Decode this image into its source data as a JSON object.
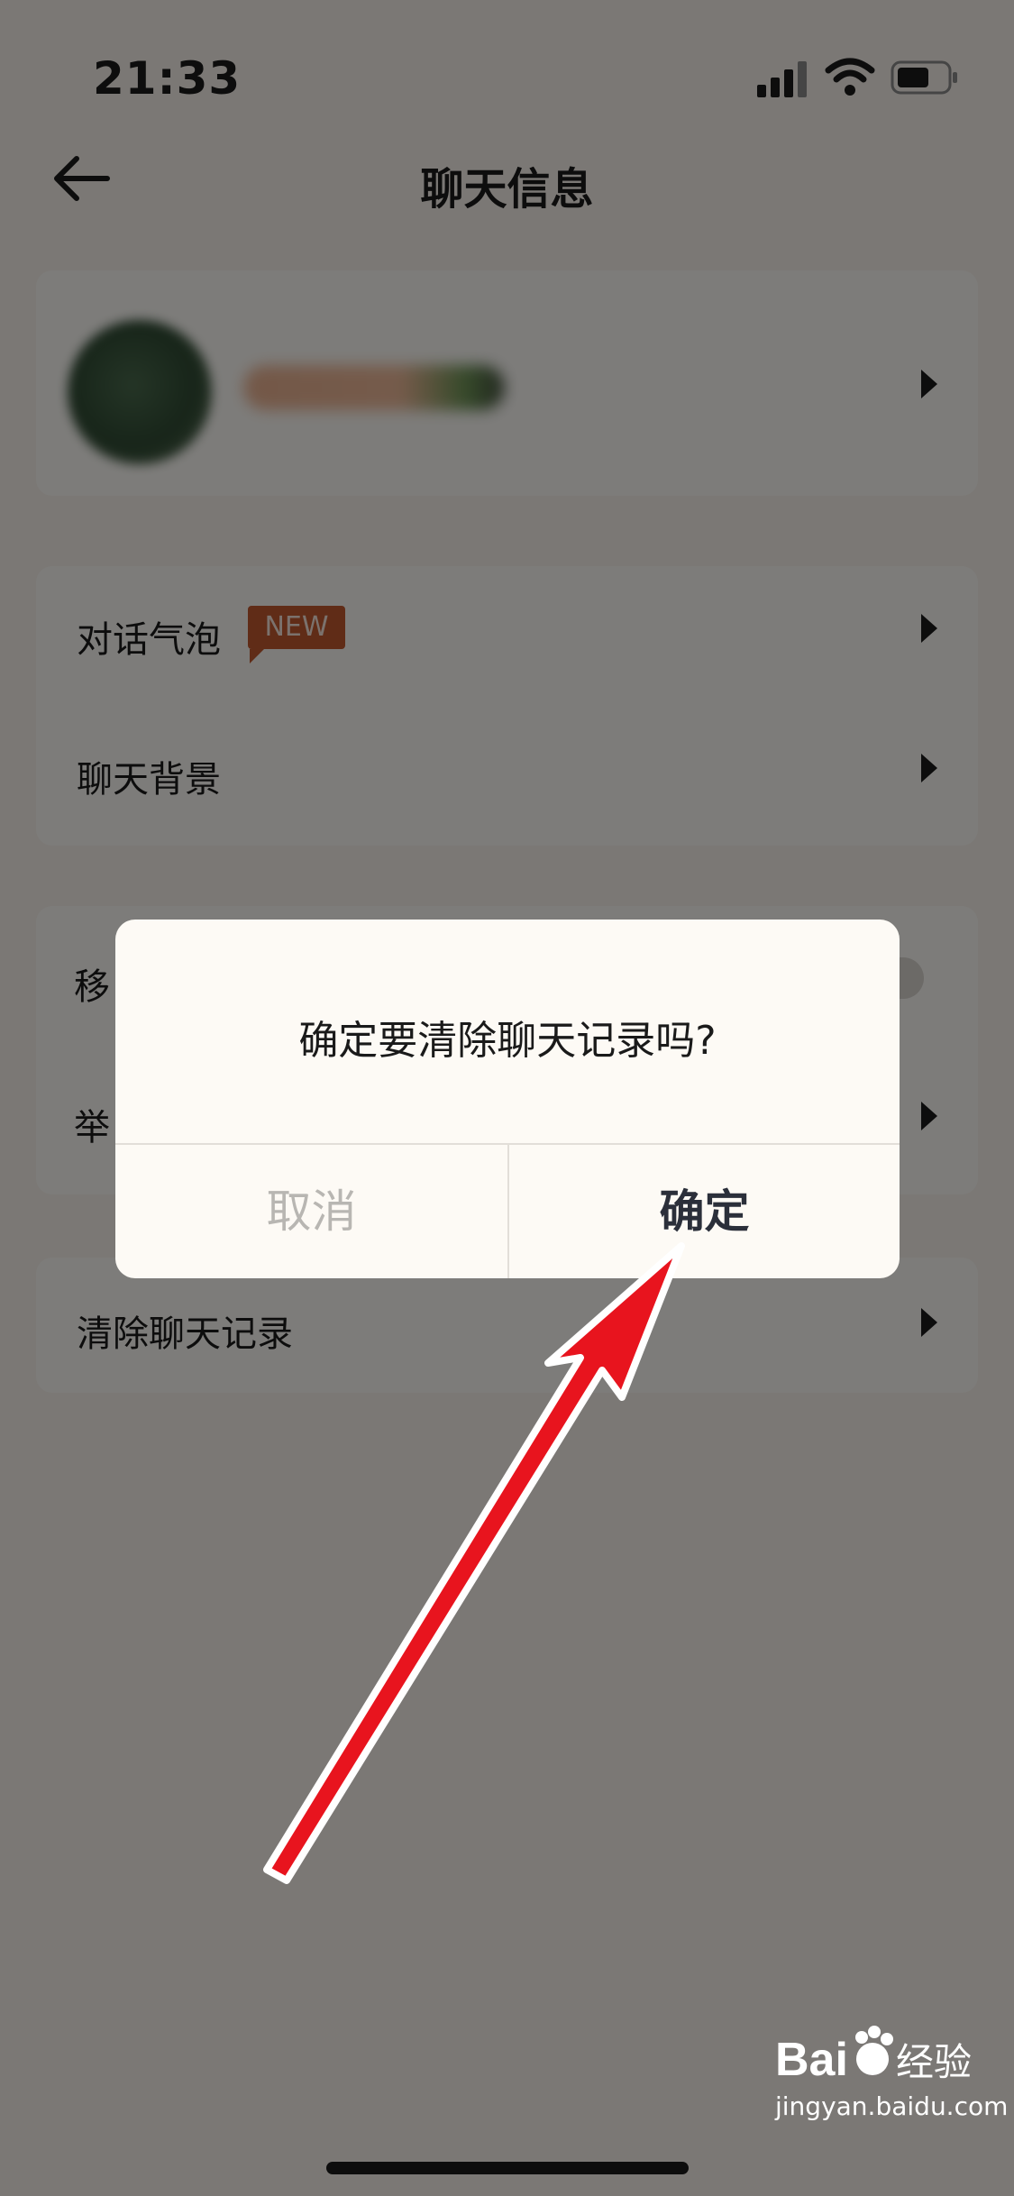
{
  "status_bar": {
    "time": "21:33"
  },
  "header": {
    "title": "聊天信息"
  },
  "menu": {
    "bubble_label": "对话气泡",
    "bubble_badge": "NEW",
    "background_label": "聊天背景",
    "remove_label_partial": "移",
    "report_label_partial": "举",
    "clear_label": "清除聊天记录"
  },
  "dialog": {
    "message": "确定要清除聊天记录吗?",
    "cancel_label": "取消",
    "confirm_label": "确定"
  },
  "watermark": {
    "brand": "Bai",
    "brand2": "经验",
    "url": "jingyan.baidu.com"
  },
  "colors": {
    "badge": "#c0582e",
    "arrow": "#e8141e",
    "dialog_bg": "#fdfaf5"
  }
}
